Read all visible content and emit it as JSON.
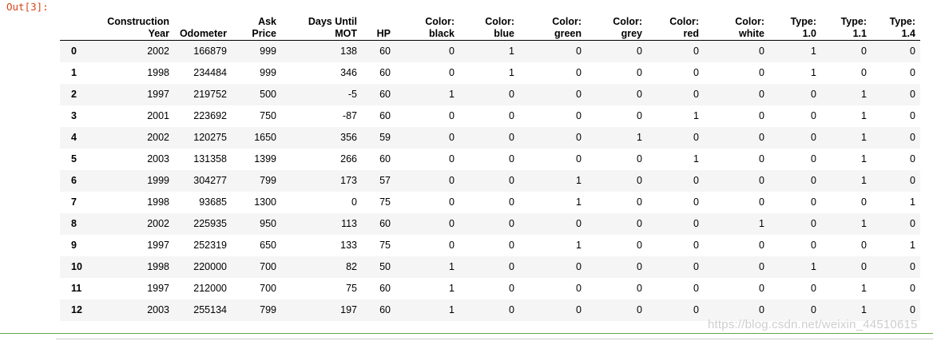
{
  "prompt": "Out[3]:",
  "table": {
    "columns": [
      "",
      "Construction\nYear",
      "Odometer",
      "Ask\nPrice",
      "Days Until\nMOT",
      "HP",
      "Color:\nblack",
      "Color:\nblue",
      "Color:\ngreen",
      "Color:\ngrey",
      "Color:\nred",
      "Color:\nwhite",
      "Type:\n1.0",
      "Type:\n1.1",
      "Type:\n1.4"
    ],
    "rows": [
      [
        "0",
        "2002",
        "166879",
        "999",
        "138",
        "60",
        "0",
        "1",
        "0",
        "0",
        "0",
        "0",
        "1",
        "0",
        "0"
      ],
      [
        "1",
        "1998",
        "234484",
        "999",
        "346",
        "60",
        "0",
        "1",
        "0",
        "0",
        "0",
        "0",
        "1",
        "0",
        "0"
      ],
      [
        "2",
        "1997",
        "219752",
        "500",
        "-5",
        "60",
        "1",
        "0",
        "0",
        "0",
        "0",
        "0",
        "0",
        "1",
        "0"
      ],
      [
        "3",
        "2001",
        "223692",
        "750",
        "-87",
        "60",
        "0",
        "0",
        "0",
        "0",
        "1",
        "0",
        "0",
        "1",
        "0"
      ],
      [
        "4",
        "2002",
        "120275",
        "1650",
        "356",
        "59",
        "0",
        "0",
        "0",
        "1",
        "0",
        "0",
        "0",
        "1",
        "0"
      ],
      [
        "5",
        "2003",
        "131358",
        "1399",
        "266",
        "60",
        "0",
        "0",
        "0",
        "0",
        "1",
        "0",
        "0",
        "1",
        "0"
      ],
      [
        "6",
        "1999",
        "304277",
        "799",
        "173",
        "57",
        "0",
        "0",
        "1",
        "0",
        "0",
        "0",
        "0",
        "1",
        "0"
      ],
      [
        "7",
        "1998",
        "93685",
        "1300",
        "0",
        "75",
        "0",
        "0",
        "1",
        "0",
        "0",
        "0",
        "0",
        "0",
        "1"
      ],
      [
        "8",
        "2002",
        "225935",
        "950",
        "113",
        "60",
        "0",
        "0",
        "0",
        "0",
        "0",
        "1",
        "0",
        "1",
        "0"
      ],
      [
        "9",
        "1997",
        "252319",
        "650",
        "133",
        "75",
        "0",
        "0",
        "1",
        "0",
        "0",
        "0",
        "0",
        "0",
        "1"
      ],
      [
        "10",
        "1998",
        "220000",
        "700",
        "82",
        "50",
        "1",
        "0",
        "0",
        "0",
        "0",
        "0",
        "1",
        "0",
        "0"
      ],
      [
        "11",
        "1997",
        "212000",
        "700",
        "75",
        "60",
        "1",
        "0",
        "0",
        "0",
        "0",
        "0",
        "0",
        "1",
        "0"
      ],
      [
        "12",
        "2003",
        "255134",
        "799",
        "197",
        "60",
        "1",
        "0",
        "0",
        "0",
        "0",
        "0",
        "0",
        "1",
        "0"
      ]
    ]
  },
  "watermark": "https://blog.csdn.net/weixin_44510615"
}
